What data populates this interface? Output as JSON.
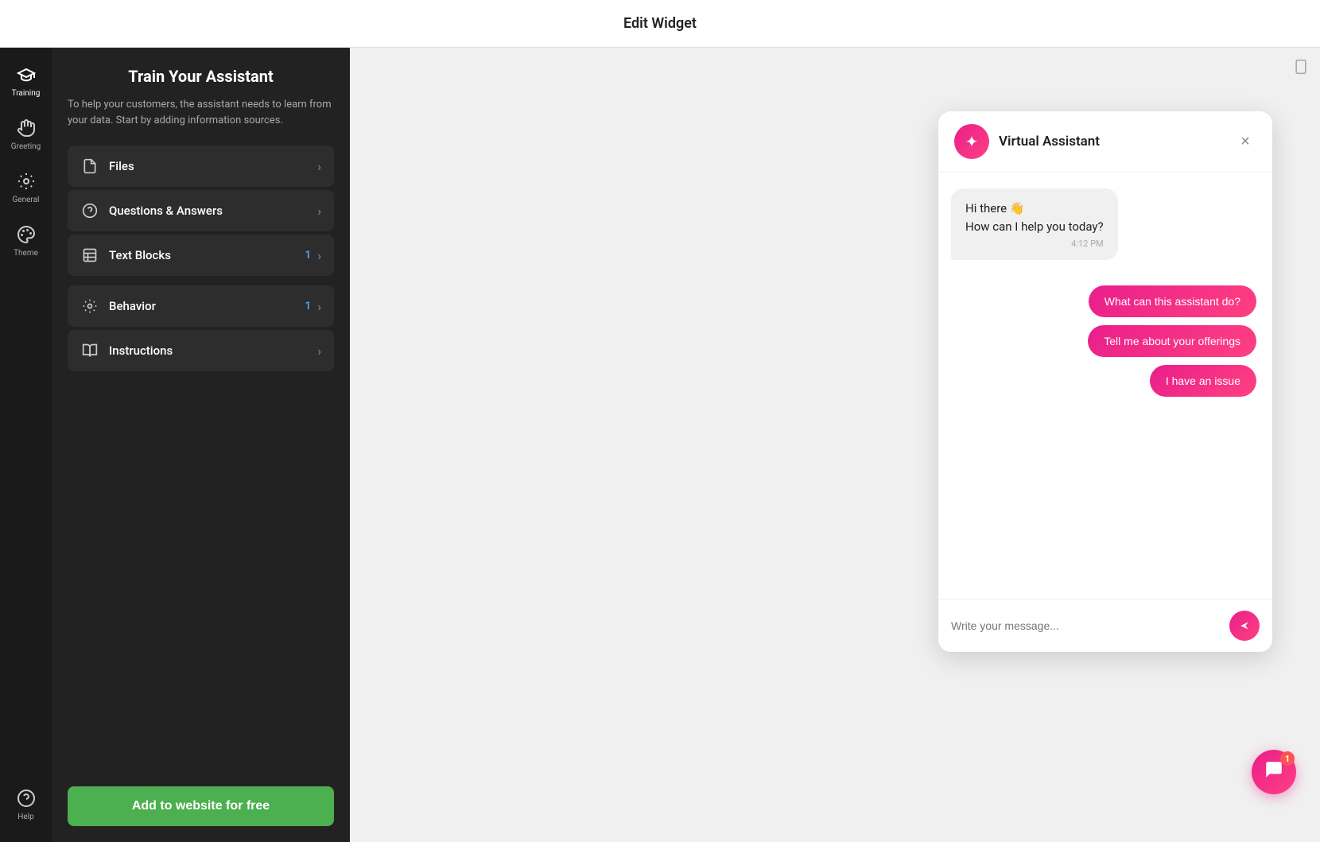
{
  "header": {
    "title": "Edit Widget"
  },
  "sidebar": {
    "items": [
      {
        "id": "training",
        "label": "Training",
        "icon": "🎓",
        "active": true
      },
      {
        "id": "greeting",
        "label": "Greeting",
        "icon": "🤝"
      },
      {
        "id": "general",
        "label": "General",
        "icon": "⚙️"
      },
      {
        "id": "theme",
        "label": "Theme",
        "icon": "🎨"
      },
      {
        "id": "help",
        "label": "Help",
        "icon": "❓"
      }
    ]
  },
  "panel": {
    "title": "Train Your Assistant",
    "subtitle": "To help your customers, the assistant needs to learn from your data. Start by adding information sources.",
    "sections": [
      {
        "items": [
          {
            "id": "files",
            "label": "Files",
            "icon": "📄",
            "badge": "",
            "chevron": true
          },
          {
            "id": "qa",
            "label": "Questions & Answers",
            "icon": "❓",
            "badge": "",
            "chevron": true
          },
          {
            "id": "text-blocks",
            "label": "Text Blocks",
            "icon": "📝",
            "badge": "1",
            "chevron": true
          }
        ]
      },
      {
        "items": [
          {
            "id": "behavior",
            "label": "Behavior",
            "icon": "⚙️",
            "badge": "1",
            "chevron": true
          },
          {
            "id": "instructions",
            "label": "Instructions",
            "icon": "📖",
            "badge": "",
            "chevron": true
          }
        ]
      }
    ],
    "footer_button": "Add to website for free"
  },
  "chat": {
    "header": {
      "avatar_icon": "✦",
      "title": "Virtual Assistant",
      "close_label": "×"
    },
    "messages": [
      {
        "type": "bot",
        "text": "Hi there 👋\nHow can I help you today?",
        "time": "4:12 PM"
      }
    ],
    "suggested": [
      {
        "id": "what-can",
        "text": "What can this assistant do?"
      },
      {
        "id": "offerings",
        "text": "Tell me about your offerings"
      },
      {
        "id": "issue",
        "text": "I have an issue"
      }
    ],
    "input": {
      "placeholder": "Write your message...",
      "send_icon": "▶"
    }
  },
  "floating": {
    "badge": "1"
  },
  "colors": {
    "accent": "#e91e8c",
    "green": "#4caf50",
    "blue": "#4a9eff"
  }
}
